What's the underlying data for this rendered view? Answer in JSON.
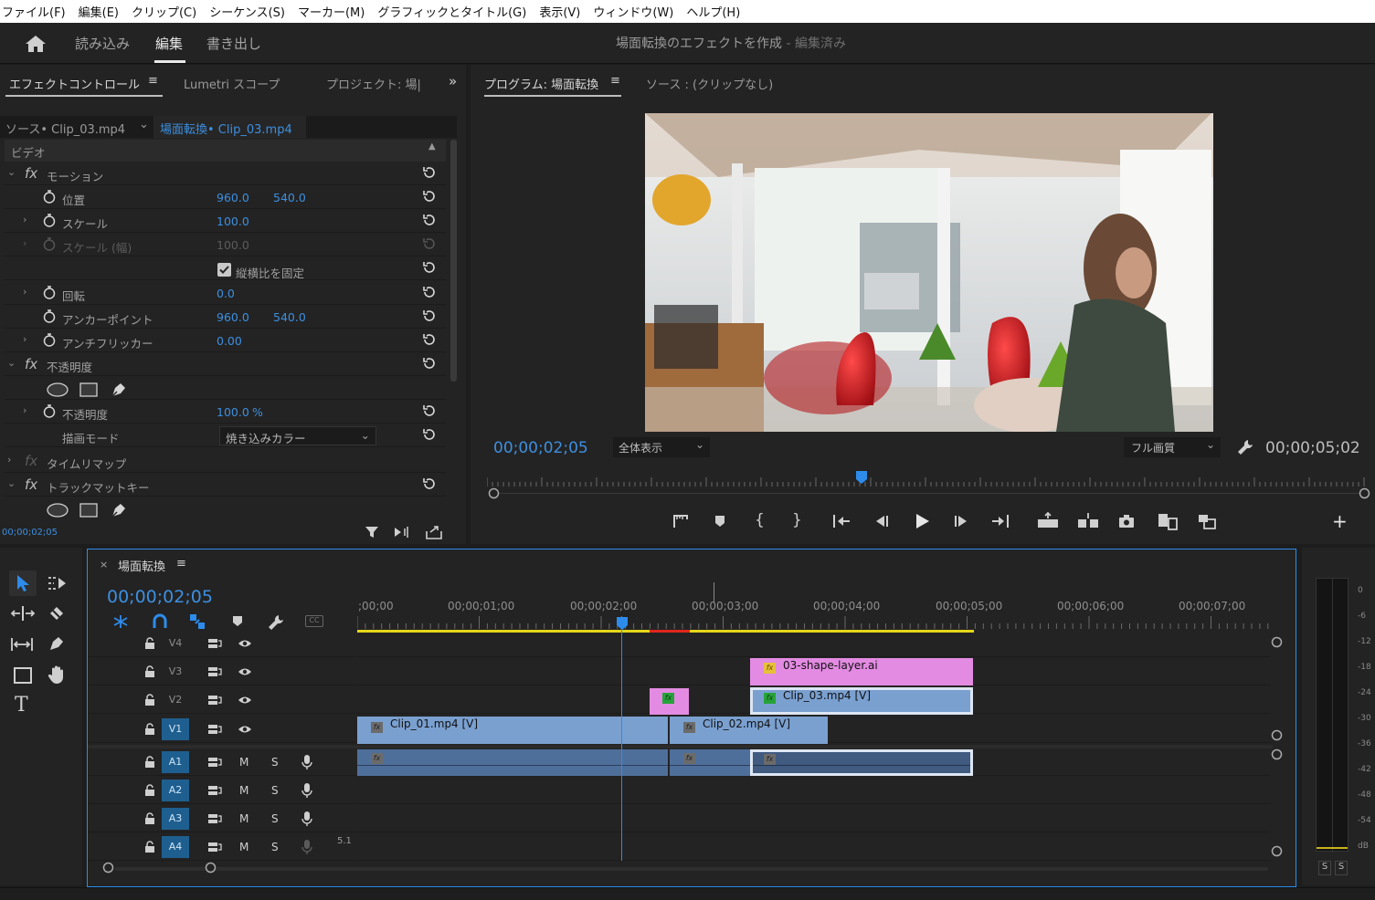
{
  "menu": [
    "ファイル(F)",
    "編集(E)",
    "クリップ(C)",
    "シーケンス(S)",
    "マーカー(M)",
    "グラフィックとタイトル(G)",
    "表示(V)",
    "ウィンドウ(W)",
    "ヘルプ(H)"
  ],
  "header": {
    "import": "読み込み",
    "edit": "編集",
    "export": "書き出し",
    "title": "場面転換のエフェクトを作成",
    "status": "- 編集済み"
  },
  "ec": {
    "tabs": {
      "effect_controls": "エフェクトコントロール",
      "lumetri": "Lumetri スコープ",
      "project": "プロジェクト: 場|"
    },
    "source": "ソース• Clip_03.mp4",
    "sequence": "場面転換• Clip_03.mp4",
    "video": "ビデオ",
    "motion": "モーション",
    "position": "位置",
    "pos_x": "960.0",
    "pos_y": "540.0",
    "scale": "スケール",
    "scale_v": "100.0",
    "scale_w": "スケール (幅)",
    "scale_w_v": "100.0",
    "uniform": "縦横比を固定",
    "rotation": "回転",
    "rotation_v": "0.0",
    "anchor": "アンカーポイント",
    "anchor_x": "960.0",
    "anchor_y": "540.0",
    "antiflicker": "アンチフリッカー",
    "antiflicker_v": "0.00",
    "opacity": "不透明度",
    "opacity_p": "不透明度",
    "opacity_v": "100.0",
    "opacity_unit": "%",
    "blend": "描画モード",
    "blend_v": "焼き込みカラー",
    "time_remap": "タイムリマップ",
    "track_matte": "トラックマットキー",
    "timecode": "00;00;02;05"
  },
  "pm": {
    "tab": "プログラム: 場面転換",
    "source_tab": "ソース : (クリップなし)",
    "timecode": "00;00;02;05",
    "fit": "全体表示",
    "quality": "フル画質",
    "duration": "00;00;05;02"
  },
  "tl": {
    "seq": "場面転換",
    "timecode": "00;00;02;05",
    "ruler": [
      ";00;00",
      "00;00;01;00",
      "00;00;02;00",
      "00;00;03;00",
      "00;00;04;00",
      "00;00;05;00",
      "00;00;06;00",
      "00;00;07;00"
    ],
    "video_tracks": [
      "V4",
      "V3",
      "V2",
      "V1"
    ],
    "audio_tracks": [
      "A1",
      "A2",
      "A3",
      "A4"
    ],
    "m": "M",
    "s": "S",
    "ch": "5.1",
    "clips": {
      "shape": "03-shape-layer.ai",
      "clip3": "Clip_03.mp4 [V]",
      "clip1": "Clip_01.mp4 [V]",
      "clip2": "Clip_02.mp4 [V]"
    }
  },
  "meter": {
    "scale": [
      "0",
      "-6",
      "-12",
      "-18",
      "-24",
      "-30",
      "-36",
      "-42",
      "-48",
      "-54",
      "dB"
    ],
    "solo": "S"
  },
  "colors": {
    "accent": "#2d8ceb",
    "video_clip": "#7aa0d0",
    "pink_clip": "#e38be2",
    "audio_clip": "#4f6f9b",
    "timecode": "#3d8fe0"
  }
}
